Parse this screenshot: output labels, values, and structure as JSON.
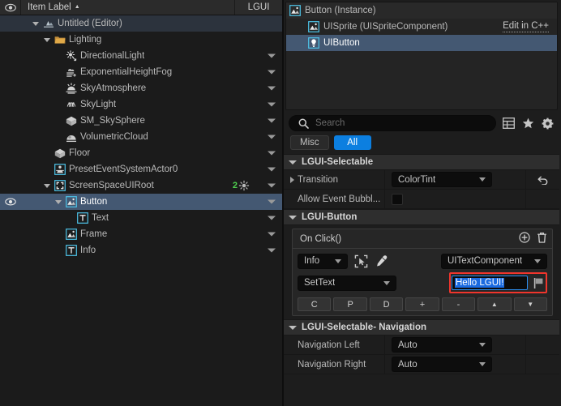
{
  "outliner": {
    "header": {
      "eye_icon": "eye-icon",
      "label": "Item Label",
      "sort_icon": "sort-ascending-icon",
      "column_lgui": "LGUI"
    },
    "rows": [
      {
        "label": "Untitled (Editor)",
        "icon": "world-icon",
        "indent": 1,
        "expander": true,
        "selected": "dark",
        "chevron": false,
        "eye": false,
        "badge": null
      },
      {
        "label": "Lighting",
        "icon": "folder-icon",
        "indent": 2,
        "expander": true,
        "selected": "none",
        "chevron": false,
        "eye": false,
        "badge": null
      },
      {
        "label": "DirectionalLight",
        "icon": "directional-light-icon",
        "indent": 3,
        "expander": false,
        "selected": "none",
        "chevron": true,
        "eye": false,
        "badge": null
      },
      {
        "label": "ExponentialHeightFog",
        "icon": "fog-icon",
        "indent": 3,
        "expander": false,
        "selected": "none",
        "chevron": true,
        "eye": false,
        "badge": null
      },
      {
        "label": "SkyAtmosphere",
        "icon": "sky-atmosphere-icon",
        "indent": 3,
        "expander": false,
        "selected": "none",
        "chevron": true,
        "eye": false,
        "badge": null
      },
      {
        "label": "SkyLight",
        "icon": "sky-light-icon",
        "indent": 3,
        "expander": false,
        "selected": "none",
        "chevron": true,
        "eye": false,
        "badge": null
      },
      {
        "label": "SM_SkySphere",
        "icon": "static-mesh-icon",
        "indent": 3,
        "expander": false,
        "selected": "none",
        "chevron": true,
        "eye": false,
        "badge": null
      },
      {
        "label": "VolumetricCloud",
        "icon": "volumetric-cloud-icon",
        "indent": 3,
        "expander": false,
        "selected": "none",
        "chevron": true,
        "eye": false,
        "badge": null
      },
      {
        "label": "Floor",
        "icon": "static-mesh-icon",
        "indent": 2,
        "expander": false,
        "selected": "none",
        "chevron": true,
        "eye": false,
        "badge": null
      },
      {
        "label": "PresetEventSystemActor0",
        "icon": "ui-actor-icon",
        "indent": 2,
        "expander": false,
        "selected": "none",
        "chevron": true,
        "eye": false,
        "badge": null
      },
      {
        "label": "ScreenSpaceUIRoot",
        "icon": "ui-root-icon",
        "indent": 2,
        "expander": true,
        "selected": "none",
        "chevron": true,
        "eye": false,
        "badge": "2"
      },
      {
        "label": "Button",
        "icon": "ui-sprite-icon",
        "indent": 3,
        "expander": true,
        "selected": "blue",
        "chevron": true,
        "eye": true,
        "badge": null
      },
      {
        "label": "Text",
        "icon": "ui-text-icon",
        "indent": 4,
        "expander": false,
        "selected": "none",
        "chevron": true,
        "eye": false,
        "badge": null
      },
      {
        "label": "Frame",
        "icon": "ui-sprite-icon",
        "indent": 3,
        "expander": false,
        "selected": "none",
        "chevron": true,
        "eye": false,
        "badge": null
      },
      {
        "label": "Info",
        "icon": "ui-text-icon",
        "indent": 3,
        "expander": false,
        "selected": "none",
        "chevron": true,
        "eye": false,
        "badge": null
      }
    ]
  },
  "details": {
    "components": [
      {
        "label": "Button (Instance)",
        "icon": "ui-sprite-icon",
        "indent": 0,
        "selected": false,
        "action": null
      },
      {
        "label": "UISprite (UISpriteComponent)",
        "icon": "ui-sprite-icon",
        "indent": 1,
        "selected": false,
        "action": "Edit in C++"
      },
      {
        "label": "UIButton",
        "icon": "ui-button-icon",
        "indent": 1,
        "selected": true,
        "action": null
      }
    ],
    "search": {
      "placeholder": "Search",
      "icons": [
        "search-icon",
        "table-view-icon",
        "favorite-star-icon",
        "settings-gear-icon"
      ]
    },
    "filters": [
      {
        "label": "Misc",
        "active": false
      },
      {
        "label": "All",
        "active": true
      }
    ],
    "categories": {
      "selectable": {
        "title": "LGUI-Selectable",
        "properties": [
          {
            "name": "Transition",
            "expandable": true,
            "type": "combo",
            "value": "ColorTint",
            "reset": true
          },
          {
            "name": "Allow Event Bubbl...",
            "expandable": false,
            "type": "checkbox",
            "value": "",
            "reset": false
          }
        ]
      },
      "button": {
        "title": "LGUI-Button",
        "event": {
          "title": "On Click()",
          "add_icon": "add-circle-icon",
          "delete_icon": "trash-icon",
          "target_object": "Info",
          "picker_icon": "actor-picker-icon",
          "eyedropper_icon": "eyedropper-icon",
          "component_type": "UITextComponent",
          "function_name": "SetText",
          "param_value": "Hello LGUI!",
          "flag_icon": "flag-icon",
          "mini_buttons": [
            "C",
            "P",
            "D",
            "+",
            "-",
            "▲",
            "▼"
          ]
        }
      },
      "navigation": {
        "title": "LGUI-Selectable- Navigation",
        "properties": [
          {
            "name": "Navigation Left",
            "type": "combo",
            "value": "Auto"
          },
          {
            "name": "Navigation Right",
            "type": "combo",
            "value": "Auto"
          }
        ]
      }
    }
  },
  "colors": {
    "accent_blue": "#0c7fe0",
    "selection_blue": "#445872",
    "highlight_red": "#f0352c",
    "icon_cyan": "#4dc3e8",
    "badge_green": "#4fd24f"
  }
}
